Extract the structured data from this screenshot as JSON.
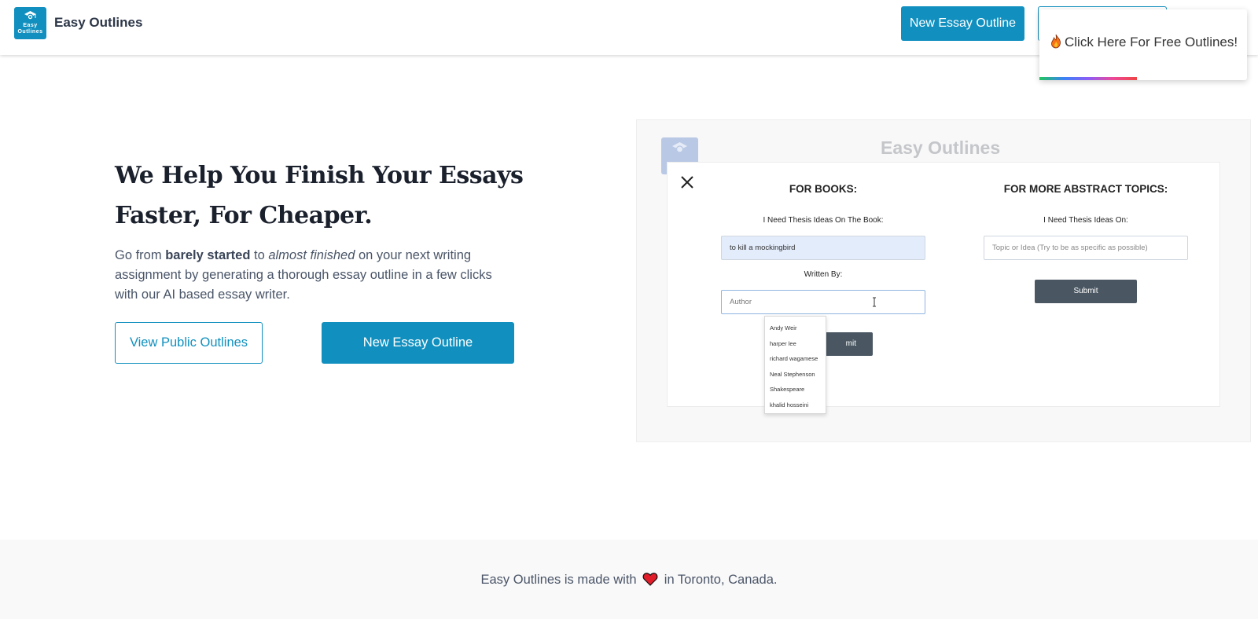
{
  "header": {
    "logo_text_1": "Easy",
    "logo_text_2": "Outlines",
    "brand": "Easy Outlines",
    "new_outline_button": "New Essay Outline"
  },
  "popup": {
    "text": "Click Here For Free Outlines!"
  },
  "hero": {
    "title": "We Help You Finish Your Essays Faster, For Cheaper.",
    "desc_1": "Go from ",
    "desc_bold": "barely started",
    "desc_2": " to ",
    "desc_italic": "almost finished",
    "desc_3": " on your next writing assignment by generating a thorough essay outline in a few clicks with our AI based essay writer.",
    "view_public_button": "View Public Outlines",
    "new_outline_button": "New Essay Outline"
  },
  "preview": {
    "brand": "Easy Outlines",
    "books_heading": "FOR BOOKS:",
    "books_label": "I Need Thesis Ideas On The Book:",
    "book_value": "to kill a mockingbird",
    "written_by_label": "Written By:",
    "author_placeholder": "Author",
    "submit_left_visible": "mit",
    "abstract_heading": "FOR MORE ABSTRACT TOPICS:",
    "abstract_label": "I Need Thesis Ideas On:",
    "topic_placeholder": "Topic or Idea (Try to be as specific as possible)",
    "submit_right": "Submit",
    "author_suggestions": [
      "Andy Weir",
      "harper lee",
      "richard wagamese",
      "Neal Stephenson",
      "Shakespeare",
      "khalid hosseini"
    ]
  },
  "footer": {
    "text_before": "Easy Outlines is made with",
    "text_after": "in Toronto, Canada."
  },
  "colors": {
    "accent": "#1190bf",
    "heart": "#e11d2a",
    "submit": "#4a5763"
  }
}
